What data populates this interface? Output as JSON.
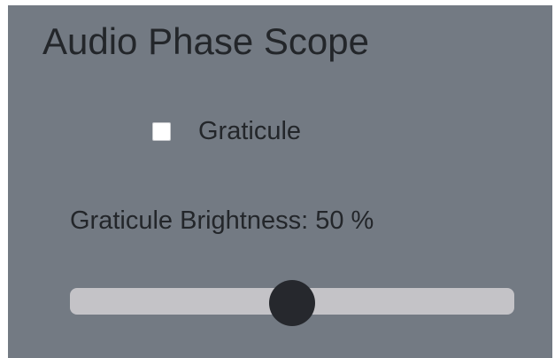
{
  "app": {
    "title": "Audio Phase Scope"
  },
  "graticule": {
    "label": "Graticule",
    "checked": false
  },
  "brightness": {
    "label_prefix": "Graticule Brightness: ",
    "value": 50,
    "unit": " %",
    "min": 0,
    "max": 100
  },
  "colors": {
    "panel_background": "#737a83",
    "text": "#23262a",
    "slider_track": "#c4c3c7",
    "slider_thumb": "#26282d",
    "checkbox_fill": "#ffffff"
  }
}
